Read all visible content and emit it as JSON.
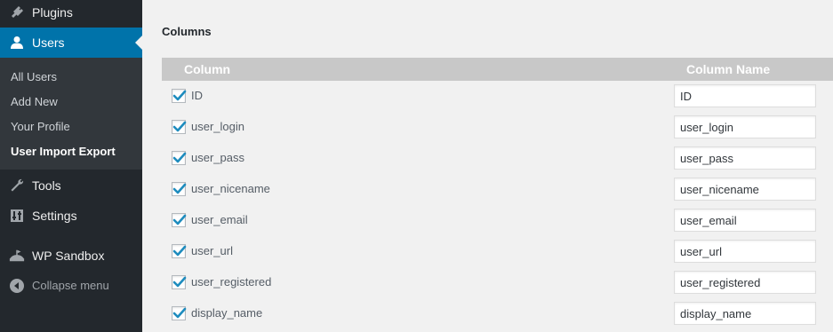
{
  "sidebar": {
    "menu": {
      "plugins": "Plugins",
      "users": "Users",
      "tools": "Tools",
      "settings": "Settings",
      "wp_sandbox": "WP Sandbox",
      "collapse": "Collapse menu"
    },
    "submenu": {
      "all_users": "All Users",
      "add_new": "Add New",
      "your_profile": "Your Profile",
      "user_import_export": "User Import Export"
    },
    "icons": [
      "plugin-icon",
      "user-icon",
      "wrench-icon",
      "sliders-icon",
      "sandbox-icon",
      "collapse-icon"
    ]
  },
  "main": {
    "section_title": "Columns",
    "table": {
      "headers": {
        "column": "Column",
        "column_name": "Column Name"
      },
      "rows": [
        {
          "label": "ID",
          "value": "ID",
          "checked": true
        },
        {
          "label": "user_login",
          "value": "user_login",
          "checked": true
        },
        {
          "label": "user_pass",
          "value": "user_pass",
          "checked": true
        },
        {
          "label": "user_nicename",
          "value": "user_nicename",
          "checked": true
        },
        {
          "label": "user_email",
          "value": "user_email",
          "checked": true
        },
        {
          "label": "user_url",
          "value": "user_url",
          "checked": true
        },
        {
          "label": "user_registered",
          "value": "user_registered",
          "checked": true
        },
        {
          "label": "display_name",
          "value": "display_name",
          "checked": true
        }
      ]
    }
  },
  "colors": {
    "sidebar_bg": "#23282d",
    "submenu_bg": "#32373c",
    "accent": "#0073aa",
    "header_bg": "#c8c8c8",
    "check": "#1e8cbe"
  }
}
